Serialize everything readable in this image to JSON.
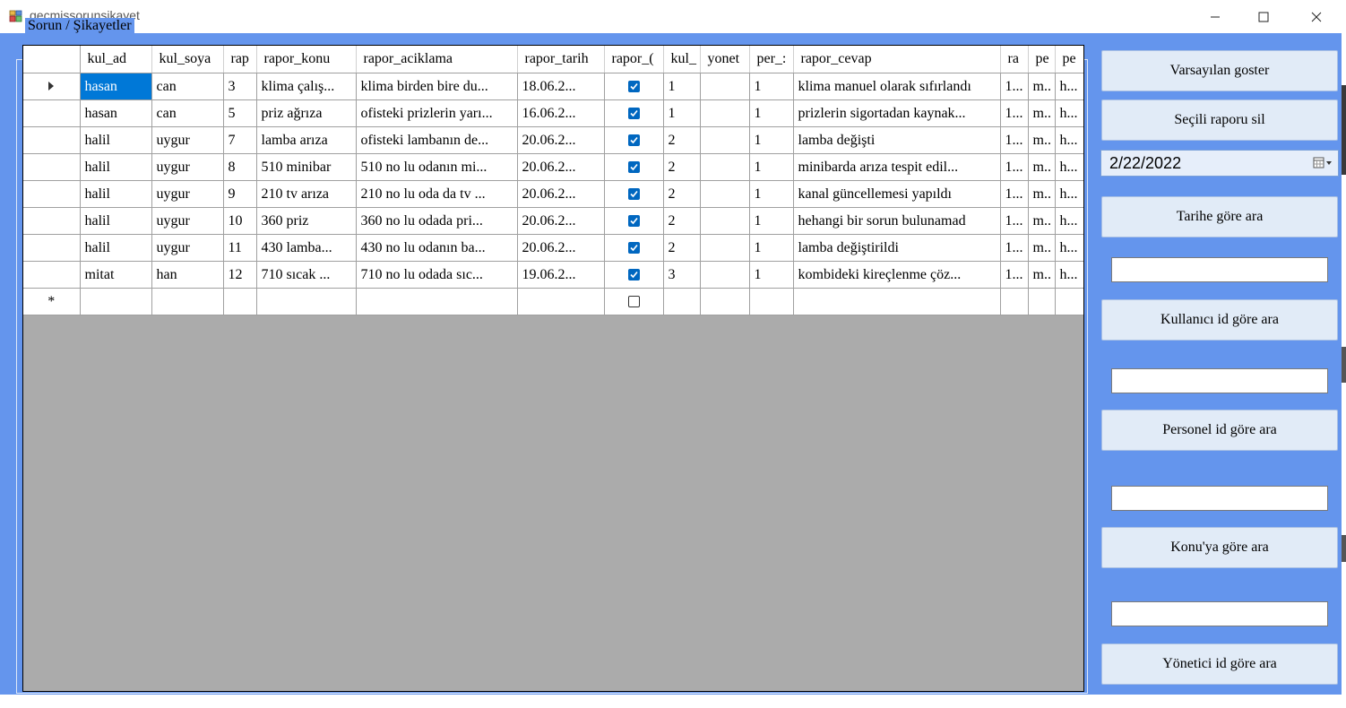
{
  "window": {
    "title": "gecmissorunsikayet"
  },
  "group": {
    "label": "Sorun / Şikayetler"
  },
  "grid": {
    "columns": [
      "kul_ad",
      "kul_soya",
      "rap",
      "rapor_konu",
      "rapor_aciklama",
      "rapor_tarih",
      "rapor_(",
      "kul_",
      "yonet",
      "per_:",
      "rapor_cevap",
      "ra",
      "pe",
      "pe"
    ],
    "rows": [
      [
        "hasan",
        "can",
        "3",
        "klima çalış...",
        "klima birden bire du...",
        "18.06.2...",
        true,
        "1",
        "",
        "1",
        "klima manuel olarak sıfırlandı",
        "1...",
        "m..",
        "h..."
      ],
      [
        "hasan",
        "can",
        "5",
        "priz ağrıza",
        "ofisteki prizlerin yarı...",
        "16.06.2...",
        true,
        "1",
        "",
        "1",
        "prizlerin sigortadan kaynak...",
        "1...",
        "m..",
        "h..."
      ],
      [
        "halil",
        "uygur",
        "7",
        "lamba arıza",
        "ofisteki lambanın de...",
        "20.06.2...",
        true,
        "2",
        "",
        "1",
        "lamba değişti",
        "1...",
        "m..",
        "h..."
      ],
      [
        "halil",
        "uygur",
        "8",
        "510 minibar",
        "510 no lu odanın mi...",
        "20.06.2...",
        true,
        "2",
        "",
        "1",
        "minibarda arıza tespit edil...",
        "1...",
        "m..",
        "h..."
      ],
      [
        "halil",
        "uygur",
        "9",
        "210 tv arıza",
        "210 no lu oda da tv ...",
        "20.06.2...",
        true,
        "2",
        "",
        "1",
        "kanal güncellemesi yapıldı",
        "1...",
        "m..",
        "h..."
      ],
      [
        "halil",
        "uygur",
        "10",
        "360 priz",
        "360 no lu odada pri...",
        "20.06.2...",
        true,
        "2",
        "",
        "1",
        "hehangi bir sorun bulunamad",
        "1...",
        "m..",
        "h..."
      ],
      [
        "halil",
        "uygur",
        "11",
        "430 lamba...",
        "430 no lu odanın ba...",
        "20.06.2...",
        true,
        "2",
        "",
        "1",
        "lamba değiştirildi",
        "1...",
        "m..",
        "h..."
      ],
      [
        "mitat",
        "han",
        "12",
        "710 sıcak ...",
        "710 no lu odada sıc...",
        "19.06.2...",
        true,
        "3",
        "",
        "1",
        "kombideki kireçlenme çöz...",
        "1...",
        "m..",
        "h..."
      ]
    ],
    "new_row_marker": "*"
  },
  "buttons": {
    "default": "Varsayılan goster",
    "delete": "Seçili raporu sil",
    "by_date": "Tarihe göre ara",
    "by_user": "Kullanıcı id göre ara",
    "by_staff": "Personel id  göre ara",
    "by_topic": "Konu'ya göre ara",
    "by_admin": "Yönetici id göre ara"
  },
  "date_picker": {
    "value": "2/22/2022"
  },
  "colors": {
    "form_bg": "#6495ed",
    "selection": "#0078d7",
    "checkbox": "#0067c0",
    "grid_empty": "#ababab"
  },
  "icons": {
    "app": "app-icon",
    "minimize": "minimize-icon",
    "maximize": "maximize-icon",
    "close": "close-icon",
    "calendar": "calendar-icon",
    "row-current": "row-pointer-icon"
  }
}
